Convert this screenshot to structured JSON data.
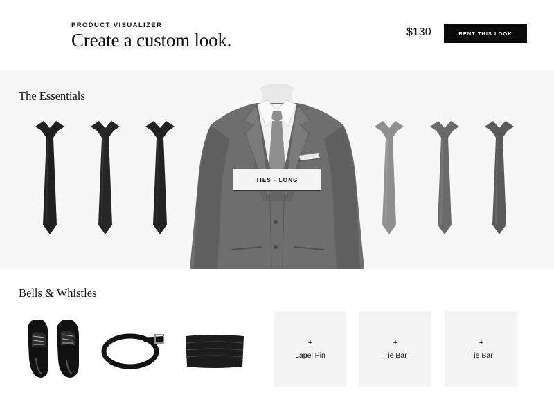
{
  "header": {
    "eyebrow": "PRODUCT VISUALIZER",
    "headline": "Create a custom look.",
    "price": "$130",
    "cta_label": "RENT THIS LOOK"
  },
  "essentials": {
    "title": "The Essentials",
    "selected_option": "TIES - LONG",
    "ties": [
      {
        "icon": "black-tie-icon",
        "color": "#1f1f1f"
      },
      {
        "icon": "black-tie-icon",
        "color": "#262626"
      },
      {
        "icon": "black-tie-icon",
        "color": "#222222"
      },
      {
        "icon": "silver-tie-icon",
        "color": "#8f8f8f"
      },
      {
        "icon": "grey-tie-icon",
        "color": "#6a6a6a"
      },
      {
        "icon": "charcoal-tie-icon",
        "color": "#5a5a5a"
      }
    ],
    "suit_icon": "grey-suit-icon",
    "suit_color": "#6e6e6e"
  },
  "bells": {
    "title": "Bells & Whistles",
    "accessories": [
      {
        "icon": "dress-shoes-icon"
      },
      {
        "icon": "belt-icon"
      },
      {
        "icon": "cummerbund-icon"
      }
    ],
    "add_tiles": [
      {
        "plus": "+",
        "label": "Lapel Pin"
      },
      {
        "plus": "+",
        "label": "Tie Bar"
      },
      {
        "plus": "+",
        "label": "Tie Bar"
      }
    ]
  }
}
